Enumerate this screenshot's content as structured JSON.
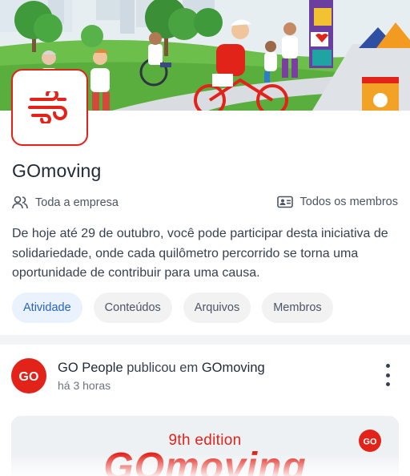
{
  "group": {
    "title": "GOmoving",
    "scope_label": "Toda a empresa",
    "members_label": "Todos os membros",
    "description": "De hoje até 29 de outubro, você pode participar desta iniciativa de solidariedade, onde cada quilômetro percorrido se torna uma oportunidade de contribuir para uma causa."
  },
  "tabs": [
    {
      "label": "Atividade",
      "active": true
    },
    {
      "label": "Conteúdos",
      "active": false
    },
    {
      "label": "Arquivos",
      "active": false
    },
    {
      "label": "Membros",
      "active": false
    }
  ],
  "post": {
    "author": "GO People",
    "action": "publicou em",
    "target": "GOmoving",
    "time": "há 3 horas",
    "avatar_text": "GO",
    "image": {
      "edition": "9th edition",
      "title": "GOmoving",
      "logo_text": "GO"
    }
  },
  "icons": {
    "scope": "people-icon",
    "members": "members-card-icon",
    "more": "more-vertical-icon",
    "group_logo": "wind-icon"
  },
  "colors": {
    "brand_red": "#e2231a",
    "active_tab_bg": "#e9f2fd",
    "active_tab_text": "#2563c9"
  }
}
